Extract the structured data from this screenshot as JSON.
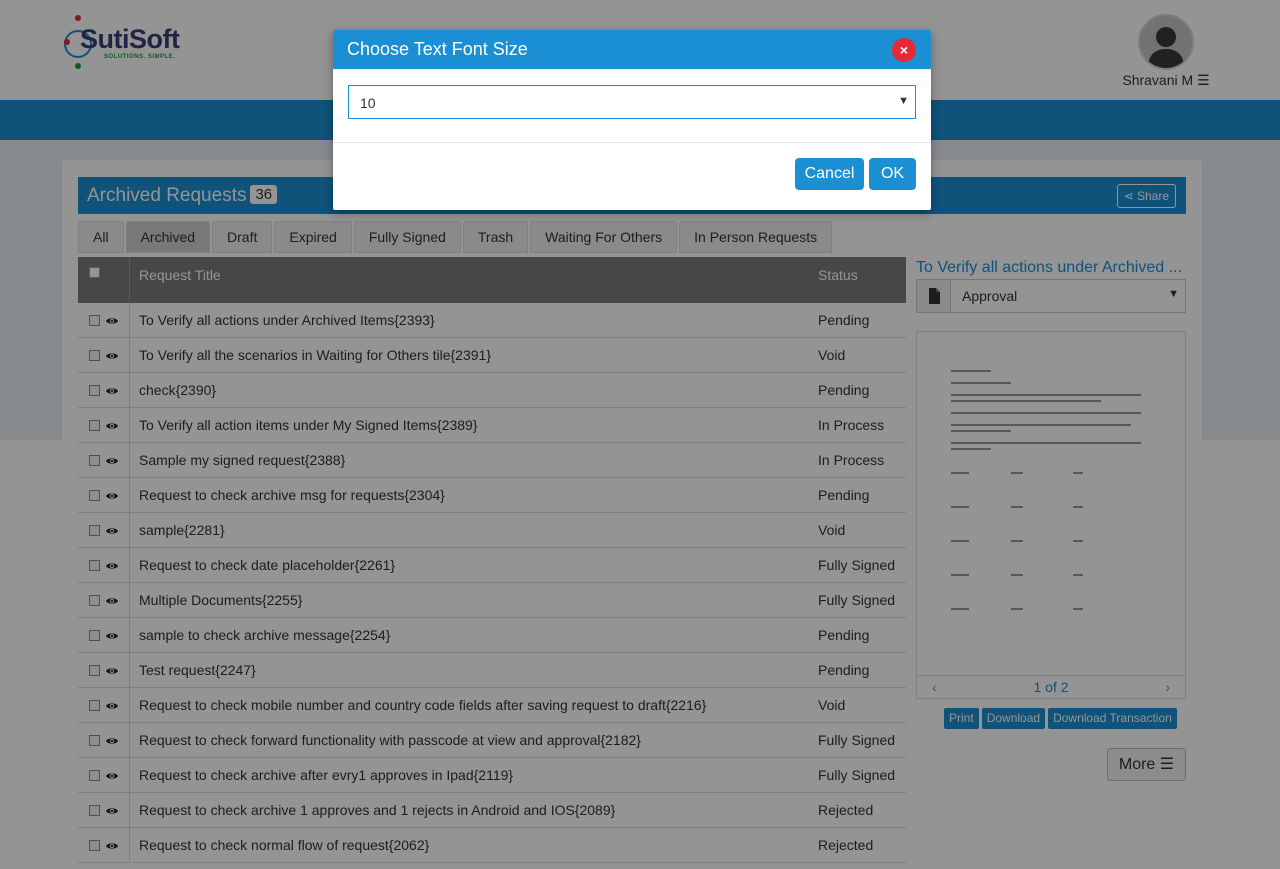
{
  "header": {
    "logo_text": "SutiSoft",
    "logo_tagline": "SOLUTIONS. SIMPLE.",
    "user_name": "Shravani M"
  },
  "panel": {
    "title": "Archived Requests",
    "count": "36",
    "share_label": "Share"
  },
  "tabs": [
    {
      "label": "All"
    },
    {
      "label": "Archived",
      "active": true
    },
    {
      "label": "Draft"
    },
    {
      "label": "Expired"
    },
    {
      "label": "Fully Signed"
    },
    {
      "label": "Trash"
    },
    {
      "label": "Waiting For Others"
    },
    {
      "label": "In Person Requests"
    }
  ],
  "table": {
    "columns": {
      "title": "Request Title",
      "status": "Status"
    },
    "rows": [
      {
        "title": "To Verify all actions under Archived Items{2393}",
        "status": "Pending"
      },
      {
        "title": "To Verify all the scenarios in Waiting for Others tile{2391}",
        "status": "Void"
      },
      {
        "title": "check{2390}",
        "status": "Pending"
      },
      {
        "title": "To Verify all action items under My Signed Items{2389}",
        "status": "In Process"
      },
      {
        "title": "Sample my signed request{2388}",
        "status": "In Process"
      },
      {
        "title": "Request to check archive msg for requests{2304}",
        "status": "Pending"
      },
      {
        "title": "sample{2281}",
        "status": "Void"
      },
      {
        "title": "Request to check date placeholder{2261}",
        "status": "Fully Signed"
      },
      {
        "title": "Multiple Documents{2255}",
        "status": "Fully Signed"
      },
      {
        "title": "sample to check archive message{2254}",
        "status": "Pending"
      },
      {
        "title": "Test request{2247}",
        "status": "Pending"
      },
      {
        "title": "Request to check mobile number and country code fields after saving request to draft{2216}",
        "status": "Void"
      },
      {
        "title": "Request to check forward functionality with passcode at view and approval{2182}",
        "status": "Fully Signed"
      },
      {
        "title": "Request to check archive after evry1 approves in Ipad{2119}",
        "status": "Fully Signed"
      },
      {
        "title": "Request to check archive 1 approves and 1 rejects in Android and IOS{2089}",
        "status": "Rejected"
      },
      {
        "title": "Request to check normal flow of request{2062}",
        "status": "Rejected"
      }
    ]
  },
  "side": {
    "title": "To Verify all actions under Archived ...",
    "doc_select_value": "Approval",
    "pager": {
      "prev": "‹",
      "text": "1 of 2",
      "next": "›"
    },
    "buttons": [
      "Print",
      "Download",
      "Download Transaction"
    ],
    "more_label": "More ☰"
  },
  "modal": {
    "title": "Choose Text Font Size",
    "close_label": "×",
    "select_value": "10",
    "cancel_label": "Cancel",
    "ok_label": "OK"
  },
  "colors": {
    "primary": "#1b8fd4",
    "close_red": "#e32a35",
    "table_header": "#7a7a7a"
  }
}
